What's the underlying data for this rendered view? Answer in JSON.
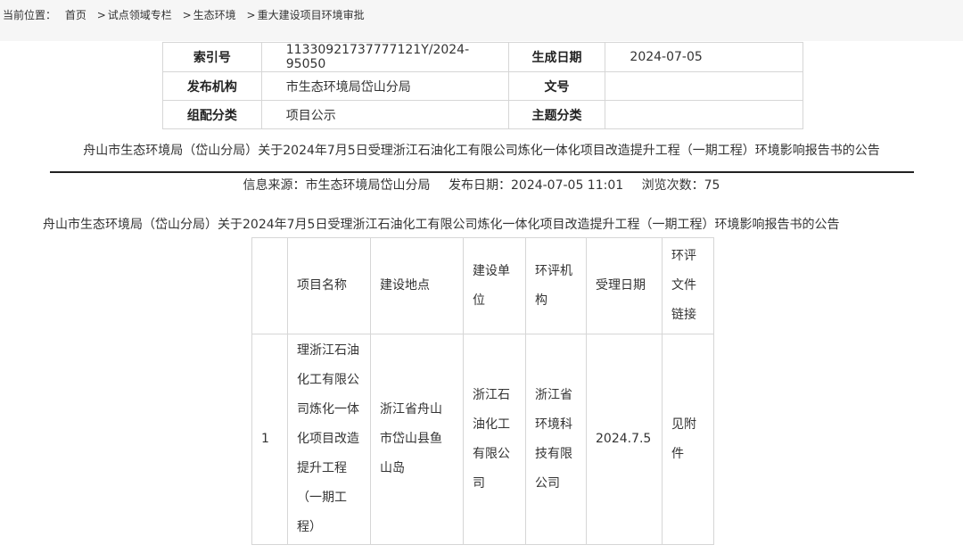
{
  "breadcrumb": {
    "label": "当前位置：",
    "items": [
      "首页",
      "试点领域专栏",
      "生态环境",
      "重大建设项目环境审批"
    ],
    "separator": ">"
  },
  "meta": {
    "index_label": "索引号",
    "index_value": "11330921737777121Y/2024-95050",
    "date_label": "生成日期",
    "date_value": "2024-07-05",
    "org_label": "发布机构",
    "org_value": "市生态环境局岱山分局",
    "docno_label": "文号",
    "docno_value": "",
    "category_label": "组配分类",
    "category_value": "项目公示",
    "topic_label": "主题分类",
    "topic_value": ""
  },
  "article": {
    "title": "舟山市生态环境局（岱山分局）关于2024年7月5日受理浙江石油化工有限公司炼化一体化项目改造提升工程（一期工程）环境影响报告书的公告",
    "source": "信息来源：市生态环境局岱山分局",
    "publish": "发布日期：2024-07-05 11:01",
    "views": "浏览次数：75",
    "body_title": "舟山市生态环境局（岱山分局）关于2024年7月5日受理浙江石油化工有限公司炼化一体化项目改造提升工程（一期工程）环境影响报告书的公告"
  },
  "table": {
    "headers": [
      "",
      "项目名称",
      "建设地点",
      "建设单位",
      "环评机构",
      "受理日期",
      "环评文件链接"
    ],
    "rows": [
      [
        "1",
        "理浙江石油化工有限公司炼化一体化项目改造提升工程（一期工程）",
        "浙江省舟山市岱山县鱼山岛",
        "浙江石油化工有限公司",
        "浙江省环境科技有限公司",
        "2024.7.5",
        "见附件"
      ]
    ]
  }
}
